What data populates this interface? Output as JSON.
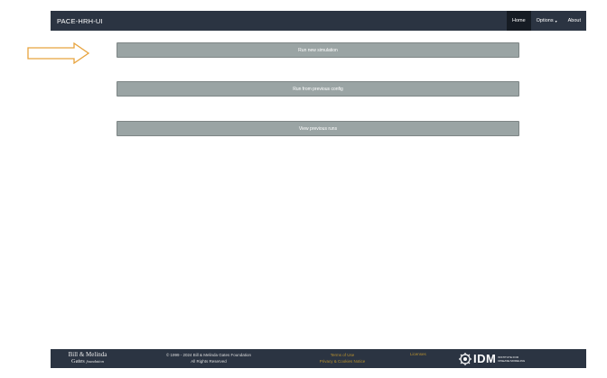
{
  "app": {
    "title": "PACE-HRH-UI"
  },
  "nav": {
    "home": "Home",
    "options": "Options",
    "options_caret": "▾",
    "about": "About"
  },
  "actions": {
    "run_new": "Run new simulation",
    "run_previous": "Run from previous config",
    "view_runs": "View previous runs"
  },
  "annotation": {
    "arrow_color": "#e8a33d",
    "icon": "right-arrow-icon"
  },
  "footer": {
    "logo_line1": "Bill & Melinda",
    "logo_line2": "Gates",
    "logo_line3": "foundation",
    "copyright_line1": "© 1999 - 2024 Bill & Melinda Gates Foundation",
    "copyright_line2": "All Rights Reserved",
    "terms": "Terms of Use",
    "privacy": "Privacy & Cookies Notice",
    "licenses": "Licenses",
    "idm_logo": "IDM",
    "idm_sub": "INSTITUTE FOR DISEASE MODELING"
  },
  "colors": {
    "navbar": "#2b3442",
    "button": "#9aa4a4",
    "link": "#b8912f"
  }
}
